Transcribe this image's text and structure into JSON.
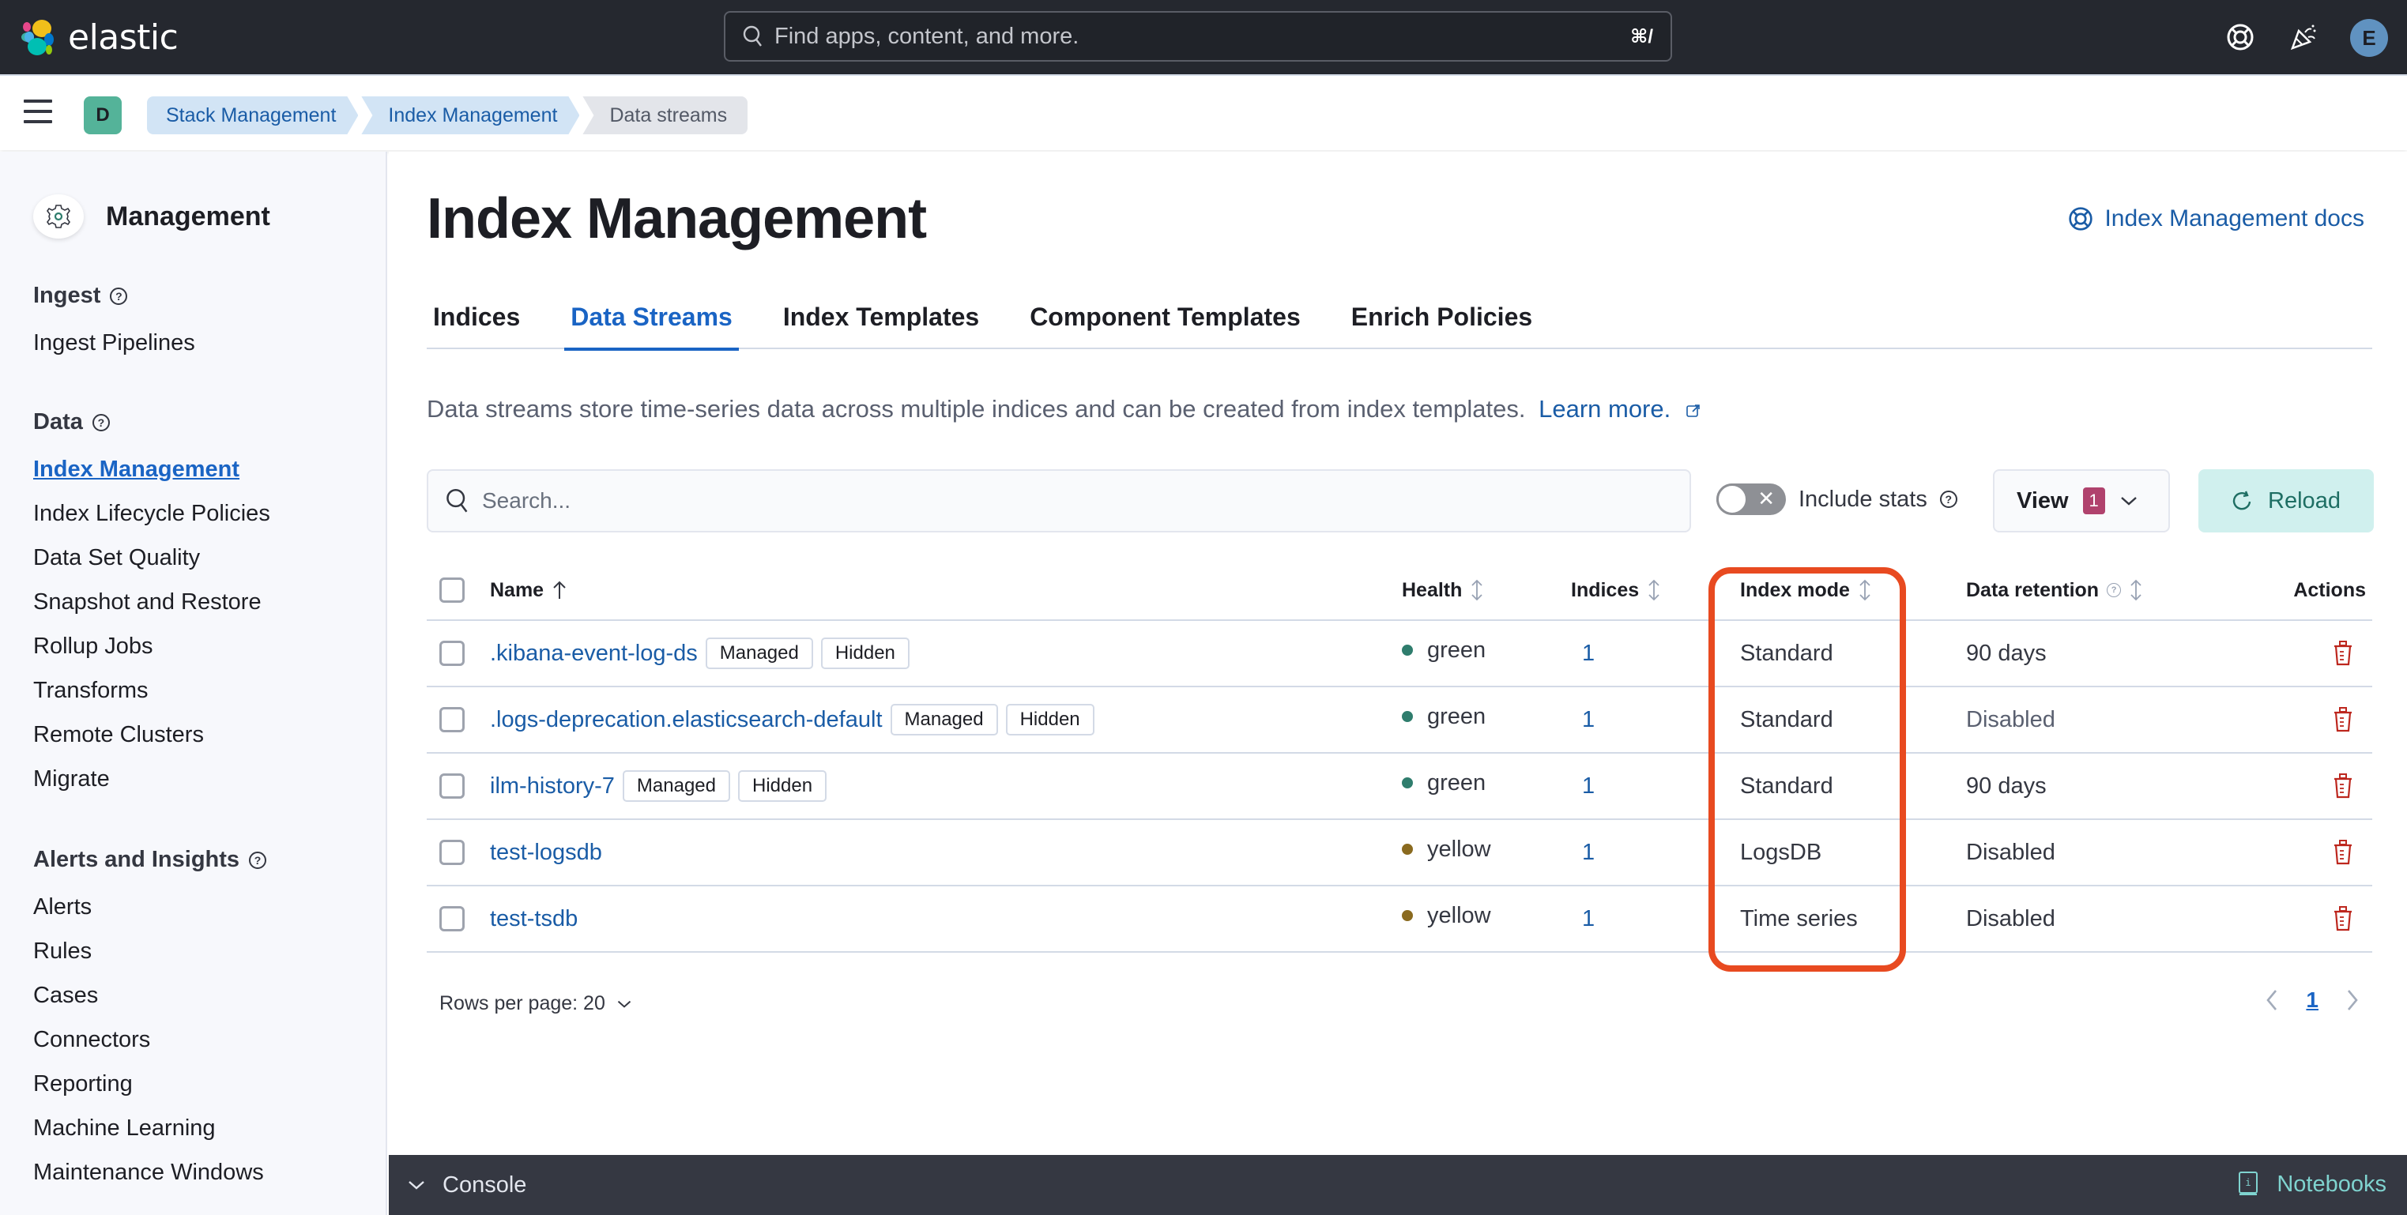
{
  "header": {
    "brand": "elastic",
    "search_placeholder": "Find apps, content, and more.",
    "search_shortcut": "⌘/",
    "help_icon": "lifebuoy-icon",
    "news_icon": "party-popper-icon",
    "user_initial": "E"
  },
  "breadcrumbs": {
    "space_initial": "D",
    "items": [
      "Stack Management",
      "Index Management",
      "Data streams"
    ]
  },
  "sidebar": {
    "title": "Management",
    "groups": [
      {
        "label": "Ingest",
        "items": [
          "Ingest Pipelines"
        ]
      },
      {
        "label": "Data",
        "items": [
          "Index Management",
          "Index Lifecycle Policies",
          "Data Set Quality",
          "Snapshot and Restore",
          "Rollup Jobs",
          "Transforms",
          "Remote Clusters",
          "Migrate"
        ]
      },
      {
        "label": "Alerts and Insights",
        "items": [
          "Alerts",
          "Rules",
          "Cases",
          "Connectors",
          "Reporting",
          "Machine Learning",
          "Maintenance Windows"
        ]
      }
    ],
    "active_item": "Index Management"
  },
  "main": {
    "title": "Index Management",
    "docs_link": "Index Management docs",
    "tabs": [
      {
        "label": "Indices",
        "active": false
      },
      {
        "label": "Data Streams",
        "active": true
      },
      {
        "label": "Index Templates",
        "active": false
      },
      {
        "label": "Component Templates",
        "active": false
      },
      {
        "label": "Enrich Policies",
        "active": false
      }
    ],
    "description": "Data streams store time-series data across multiple indices and can be created from index templates.",
    "learn_more": "Learn more.",
    "search_placeholder": "Search...",
    "include_stats_label": "Include stats",
    "include_stats_on": false,
    "view_label": "View",
    "view_count": "1",
    "reload_label": "Reload"
  },
  "table": {
    "columns": [
      "Name",
      "Health",
      "Indices",
      "Index mode",
      "Data retention",
      "Actions"
    ],
    "sorted_column": "Name",
    "sort_direction": "ascending",
    "rows": [
      {
        "name": ".kibana-event-log-ds",
        "badges": [
          "Managed",
          "Hidden"
        ],
        "health": "green",
        "indices": "1",
        "index_mode": "Standard",
        "data_retention": "90 days"
      },
      {
        "name": ".logs-deprecation.elasticsearch-default",
        "badges": [
          "Managed",
          "Hidden"
        ],
        "health": "green",
        "indices": "1",
        "index_mode": "Standard",
        "data_retention": "Disabled"
      },
      {
        "name": "ilm-history-7",
        "badges": [
          "Managed",
          "Hidden"
        ],
        "health": "green",
        "indices": "1",
        "index_mode": "Standard",
        "data_retention": "90 days"
      },
      {
        "name": "test-logsdb",
        "badges": [],
        "health": "yellow",
        "indices": "1",
        "index_mode": "LogsDB",
        "data_retention": "Disabled"
      },
      {
        "name": "test-tsdb",
        "badges": [],
        "health": "yellow",
        "indices": "1",
        "index_mode": "Time series",
        "data_retention": "Disabled"
      }
    ],
    "health_colors": {
      "green": "#2f7d6d",
      "yellow": "#8a6a1f"
    },
    "delete_color": "#bd271e",
    "highlighted_column": "Index mode",
    "highlight_color": "#e84a20"
  },
  "pagination": {
    "rows_per_page": "Rows per page: 20",
    "current_page": "1"
  },
  "footer": {
    "console_label": "Console",
    "notebooks_label": "Notebooks"
  }
}
